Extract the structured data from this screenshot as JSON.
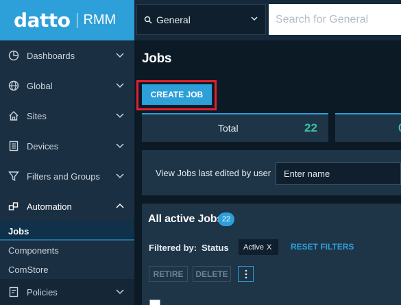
{
  "brand": {
    "logo_word": "datto",
    "product": "RMM",
    "color": "#2d9fd9"
  },
  "topbar": {
    "scope_value": "General",
    "search_placeholder": "Search for General"
  },
  "sidebar": {
    "items": [
      {
        "label": "Dashboards",
        "icon": "pie-chart-icon",
        "expanded": false
      },
      {
        "label": "Global",
        "icon": "globe-icon",
        "expanded": false
      },
      {
        "label": "Sites",
        "icon": "home-icon",
        "expanded": false
      },
      {
        "label": "Devices",
        "icon": "device-list-icon",
        "expanded": false
      },
      {
        "label": "Filters and Groups",
        "icon": "filter-icon",
        "expanded": false
      },
      {
        "label": "Automation",
        "icon": "automation-icon",
        "expanded": true
      },
      {
        "label": "Policies",
        "icon": "policy-icon",
        "expanded": false
      }
    ],
    "subitems": [
      {
        "label": "Jobs",
        "active": true
      },
      {
        "label": "Components",
        "active": false
      },
      {
        "label": "ComStore",
        "active": false
      }
    ]
  },
  "main": {
    "title": "Jobs",
    "create_button": "CREATE JOB",
    "stats": {
      "total_label": "Total",
      "total_value": "22",
      "next_value": "0"
    },
    "filter": {
      "label": "View Jobs last edited by user",
      "placeholder": "Enter name"
    },
    "jobs_panel": {
      "title": "All active Jobs",
      "count": "22",
      "filtered_by": "Filtered by:",
      "status_label": "Status",
      "chip": "Active",
      "chip_close": "X",
      "reset": "RESET FILTERS",
      "retire": "RETIRE",
      "delete": "DELETE"
    }
  },
  "colors": {
    "accent": "#2d9fd9",
    "success": "#3cc0a6",
    "highlight": "#e3212f"
  }
}
